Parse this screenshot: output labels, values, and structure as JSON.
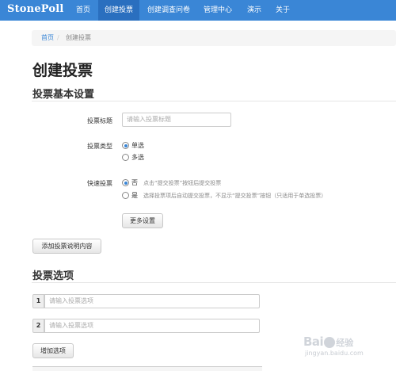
{
  "navbar": {
    "brand": "StonePoll",
    "items": [
      {
        "label": "首页"
      },
      {
        "label": "创建投票"
      },
      {
        "label": "创建调查问卷"
      },
      {
        "label": "管理中心"
      },
      {
        "label": "演示"
      },
      {
        "label": "关于"
      }
    ]
  },
  "breadcrumb": {
    "home": "首页",
    "separator": "/",
    "current": "创建投票"
  },
  "page_title": "创建投票",
  "basic_settings": {
    "title": "投票基本设置",
    "vote_title": {
      "label": "投票标题",
      "placeholder": "请输入投票标题"
    },
    "vote_type": {
      "label": "投票类型",
      "options": [
        {
          "label": "单选",
          "checked": true
        },
        {
          "label": "多选",
          "checked": false
        }
      ]
    },
    "quick_vote": {
      "label": "快速投票",
      "options": [
        {
          "label": "否",
          "hint": "点击“提交投票”按钮后提交投票",
          "checked": true
        },
        {
          "label": "是",
          "hint": "选择投票项后自动提交投票，不显示“提交投票”按钮（只适用于单选投票）",
          "checked": false
        }
      ]
    },
    "more_settings_button": "更多设置"
  },
  "add_description_button": "添加投票说明内容",
  "options_section": {
    "title": "投票选项",
    "options": [
      {
        "number": "1",
        "placeholder": "请输入投票选项"
      },
      {
        "number": "2",
        "placeholder": "请输入投票选项"
      }
    ],
    "add_option_button": "增加选项"
  },
  "watermark": {
    "logo": "Bai",
    "logo_end": "经验",
    "url": "jingyan.baidu.com"
  },
  "colors": {
    "navbar": "#3a86d6",
    "navbar_active": "#2a6fbf",
    "radio_checked": "#3a86d6"
  }
}
